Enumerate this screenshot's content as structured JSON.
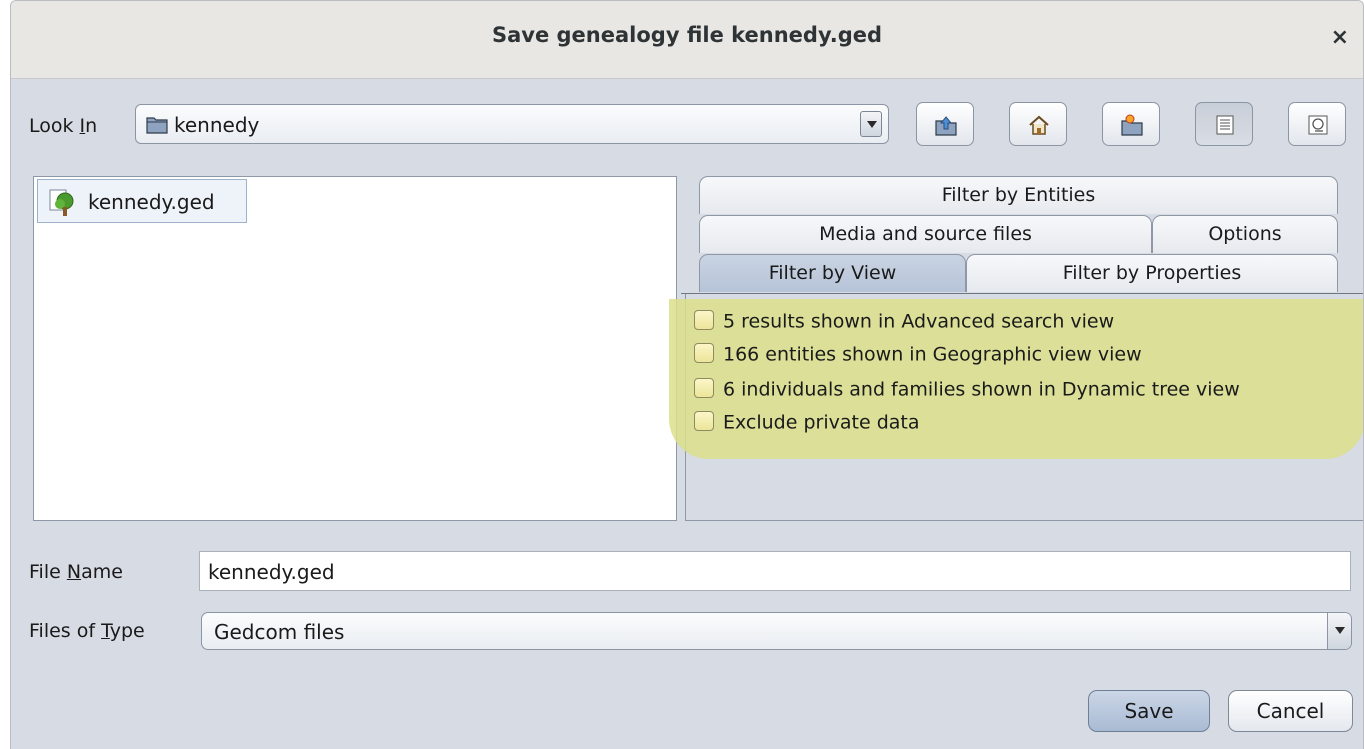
{
  "window": {
    "title": "Save genealogy file kennedy.ged",
    "close_label": "×"
  },
  "look_in": {
    "label_pre": "Look ",
    "label_mnemonic": "I",
    "label_post": "n",
    "value": "kennedy"
  },
  "toolbar": {
    "icons": [
      "up-folder-icon",
      "home-icon",
      "new-folder-icon",
      "list-view-icon",
      "details-view-icon"
    ]
  },
  "files": [
    {
      "name": "kennedy.ged",
      "icon": "family-tree-file-icon"
    }
  ],
  "tabs": {
    "row1": [
      "Filter by Entities"
    ],
    "row2": [
      "Media and source files",
      "Options"
    ],
    "row3": [
      "Filter by View",
      "Filter by Properties"
    ],
    "selected": "Filter by View"
  },
  "filter_view": {
    "highlight_color": "#dcdf8a",
    "options": [
      {
        "label": "5 results shown in Advanced search view",
        "checked": false
      },
      {
        "label": "166 entities shown in Geographic view view",
        "checked": false
      },
      {
        "label": "6 individuals and families shown in Dynamic tree view",
        "checked": false
      },
      {
        "label": "Exclude private data",
        "checked": false
      }
    ]
  },
  "file_name": {
    "label_pre": "File ",
    "label_mnemonic": "N",
    "label_post": "ame",
    "value": "kennedy.ged"
  },
  "file_type": {
    "label_pre": "Files of ",
    "label_mnemonic": "T",
    "label_post": "ype",
    "value": "Gedcom files"
  },
  "buttons": {
    "save": "Save",
    "cancel": "Cancel"
  }
}
